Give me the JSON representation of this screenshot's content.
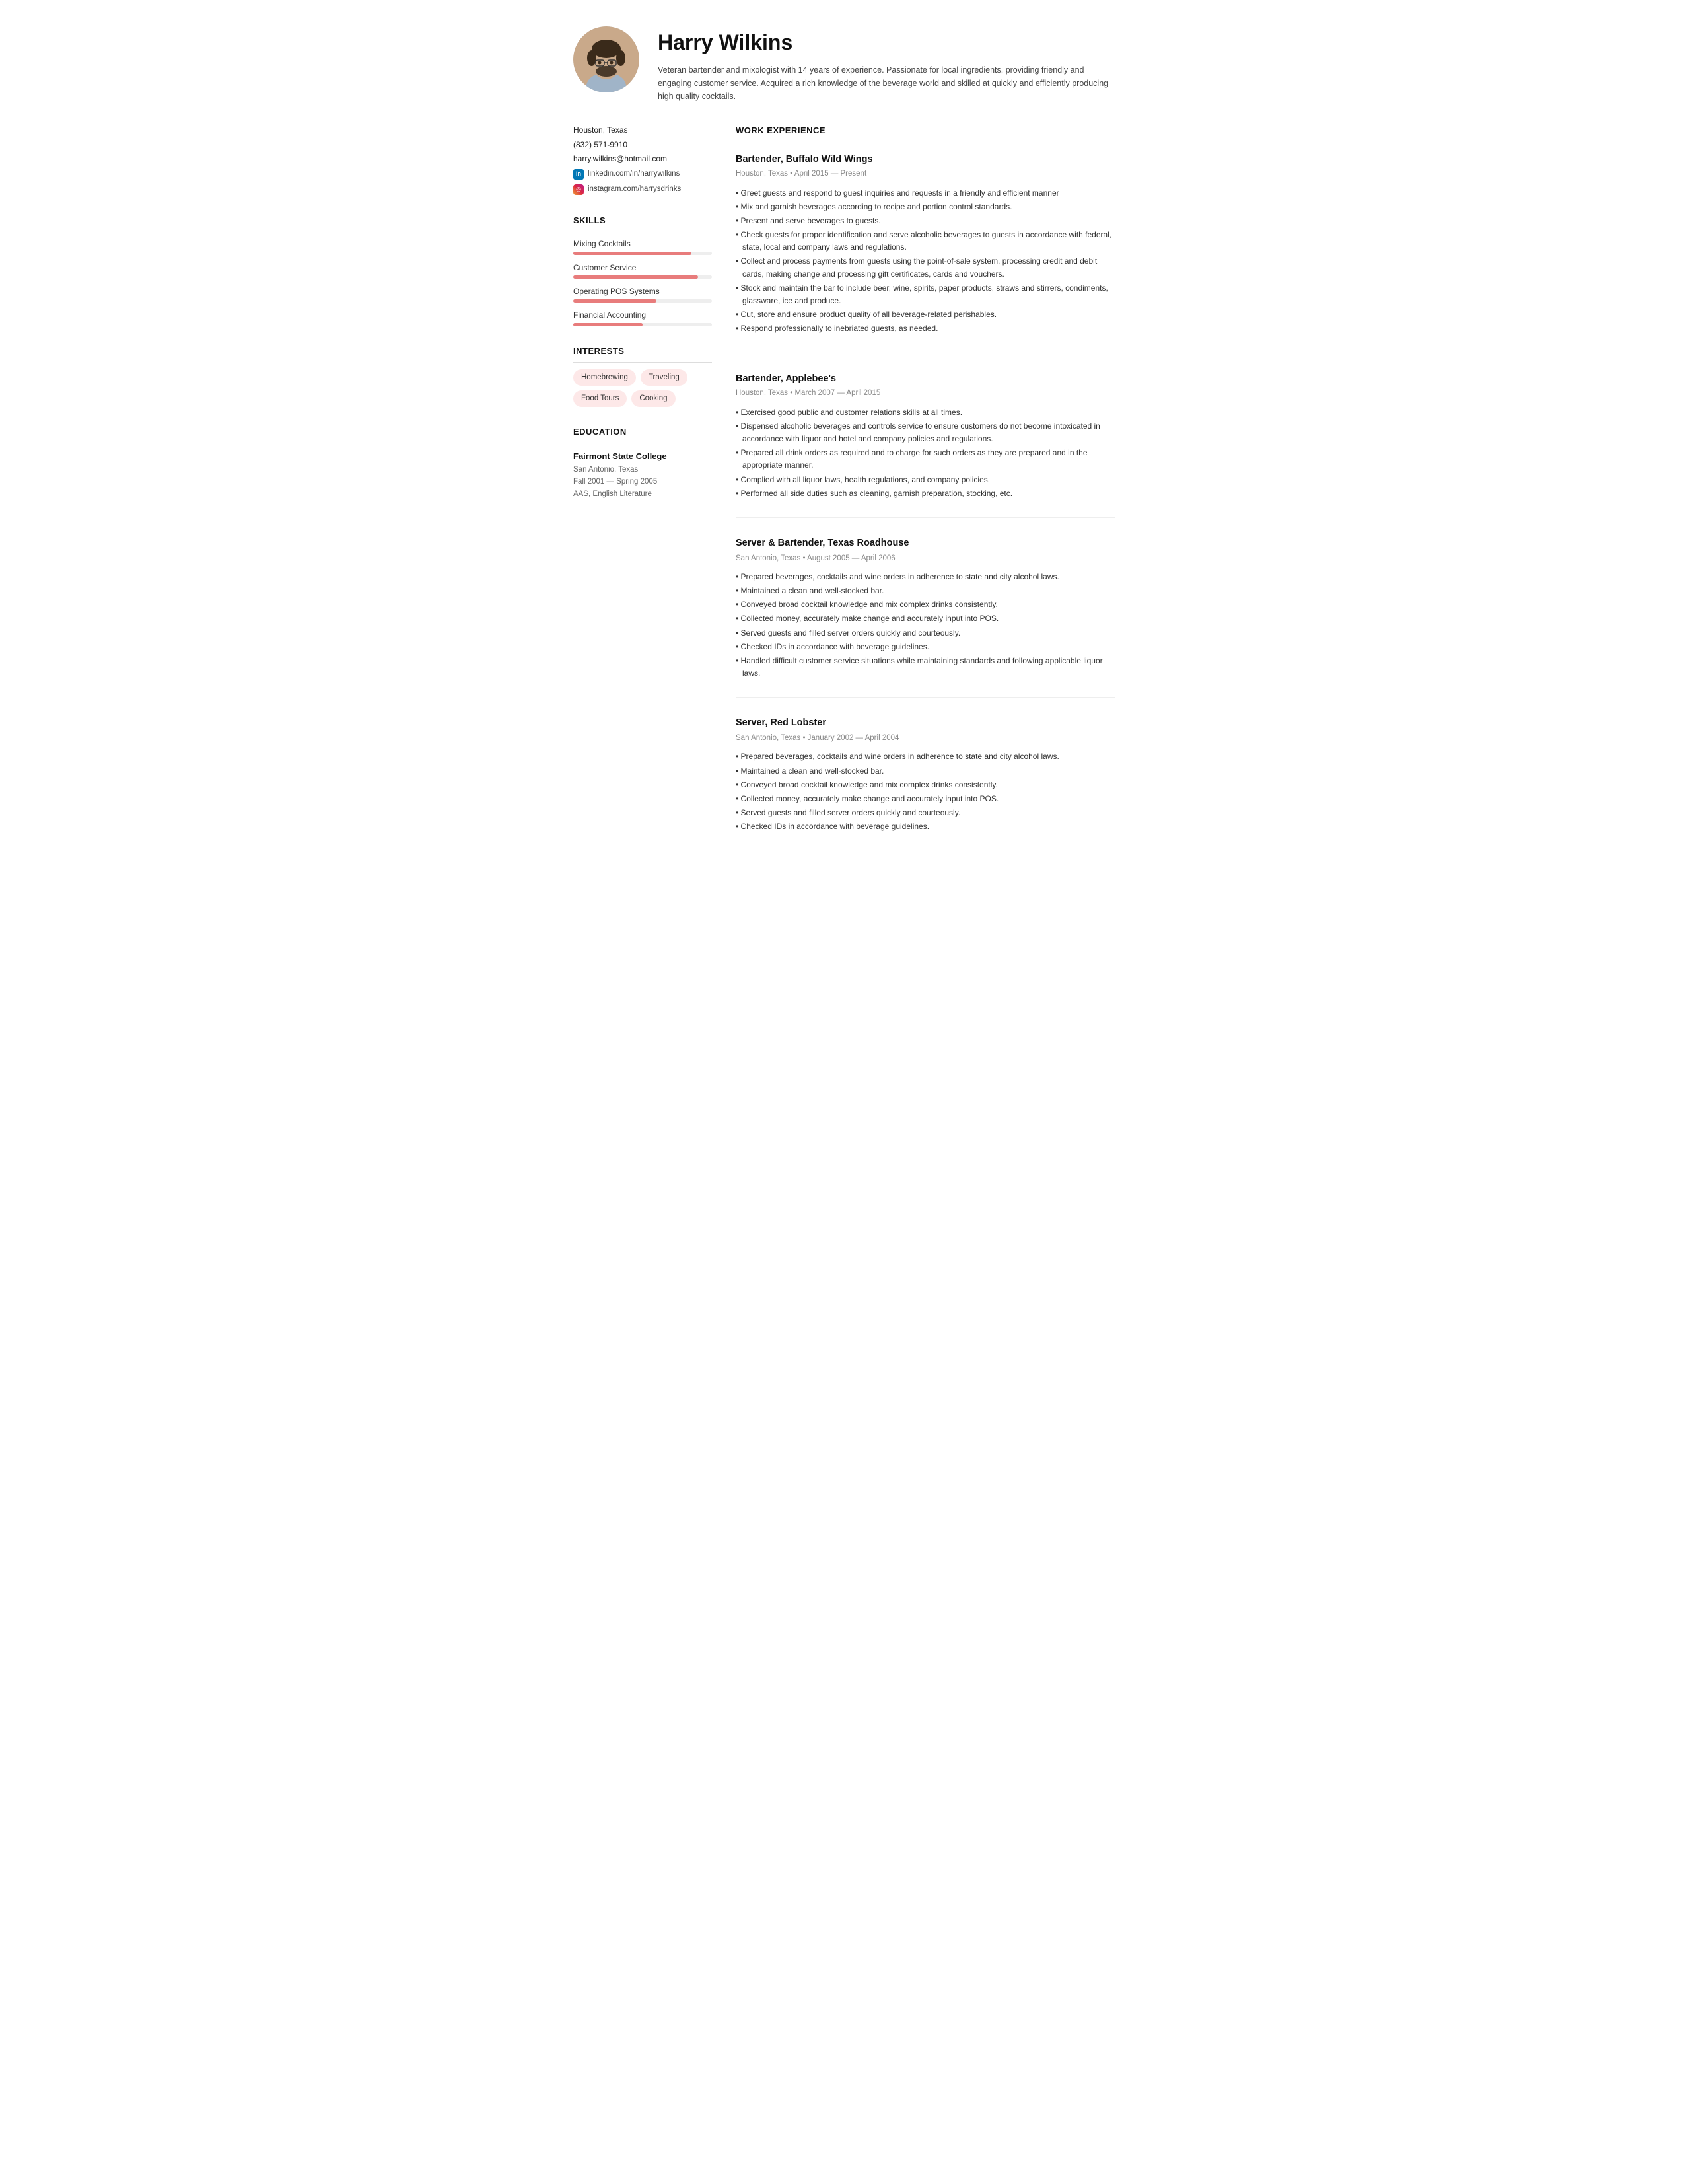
{
  "header": {
    "name": "Harry Wilkins",
    "summary": "Veteran bartender and mixologist with 14 years of experience. Passionate for local ingredients, providing friendly and engaging customer service. Acquired a rich knowledge of the beverage world and skilled at quickly and efficiently producing high quality cocktails."
  },
  "contact": {
    "location": "Houston, Texas",
    "phone": "(832) 571-9910",
    "email": "harry.wilkins@hotmail.com",
    "linkedin": "linkedin.com/in/harrywilkins",
    "instagram": "instagram.com/harrysdrinks"
  },
  "skills_section_title": "SKILLS",
  "skills": [
    {
      "label": "Mixing Cocktails",
      "percent": 85
    },
    {
      "label": "Customer Service",
      "percent": 90
    },
    {
      "label": "Operating POS Systems",
      "percent": 60
    },
    {
      "label": "Financial Accounting",
      "percent": 50
    }
  ],
  "interests_section_title": "INTERESTS",
  "interests": [
    "Homebrewing",
    "Traveling",
    "Food Tours",
    "Cooking"
  ],
  "education_section_title": "EDUCATION",
  "education": {
    "school": "Fairmont State College",
    "location": "San Antonio, Texas",
    "dates": "Fall 2001 — Spring 2005",
    "degree": "AAS, English Literature"
  },
  "work_section_title": "WORK EXPERIENCE",
  "jobs": [
    {
      "title": "Bartender, Buffalo Wild Wings",
      "meta": "Houston, Texas • April 2015 — Present",
      "bullets": [
        "Greet guests and respond to guest inquiries and requests in a friendly and efficient manner",
        "Mix and garnish beverages according to recipe and portion control standards.",
        "Present and serve beverages to guests.",
        "Check guests for proper identification and serve alcoholic beverages to guests in accordance with federal, state, local and company laws and regulations.",
        "Collect and process payments from guests using the point-of-sale system, processing credit and debit cards, making change and processing gift certificates, cards and vouchers.",
        "Stock and maintain the bar to include beer, wine, spirits, paper products, straws and stirrers, condiments, glassware, ice and produce.",
        "Cut, store and ensure product quality of all beverage-related perishables.",
        "Respond professionally to inebriated guests, as needed."
      ]
    },
    {
      "title": "Bartender, Applebee's",
      "meta": "Houston, Texas • March 2007 — April 2015",
      "bullets": [
        "Exercised good public and customer relations skills at all times.",
        "Dispensed alcoholic beverages and controls service to ensure customers do not become intoxicated in accordance with liquor and hotel and company policies and regulations.",
        "Prepared all drink orders as required and to charge for such orders as they are prepared and in the appropriate manner.",
        "Complied with all liquor laws, health regulations, and company policies.",
        "Performed all side duties such as cleaning, garnish preparation, stocking, etc."
      ]
    },
    {
      "title": "Server & Bartender, Texas Roadhouse",
      "meta": "San Antonio, Texas • August 2005 — April 2006",
      "bullets": [
        "Prepared beverages, cocktails and wine orders in adherence to state and city alcohol laws.",
        "Maintained a clean and well-stocked bar.",
        "Conveyed broad cocktail knowledge and mix complex drinks consistently.",
        "Collected money, accurately make change and accurately input into POS.",
        "Served guests and filled server orders quickly and courteously.",
        "Checked IDs in accordance with beverage guidelines.",
        "Handled difficult customer service situations while maintaining standards and following applicable liquor laws."
      ]
    },
    {
      "title": "Server, Red Lobster",
      "meta": "San Antonio, Texas • January 2002 — April 2004",
      "bullets": [
        "Prepared beverages, cocktails and wine orders in adherence to state and city alcohol laws.",
        "Maintained a clean and well-stocked bar.",
        "Conveyed broad cocktail knowledge and mix complex drinks consistently.",
        "Collected money, accurately make change and accurately input into POS.",
        "Served guests and filled server orders quickly and courteously.",
        "Checked IDs in accordance with beverage guidelines."
      ]
    }
  ]
}
